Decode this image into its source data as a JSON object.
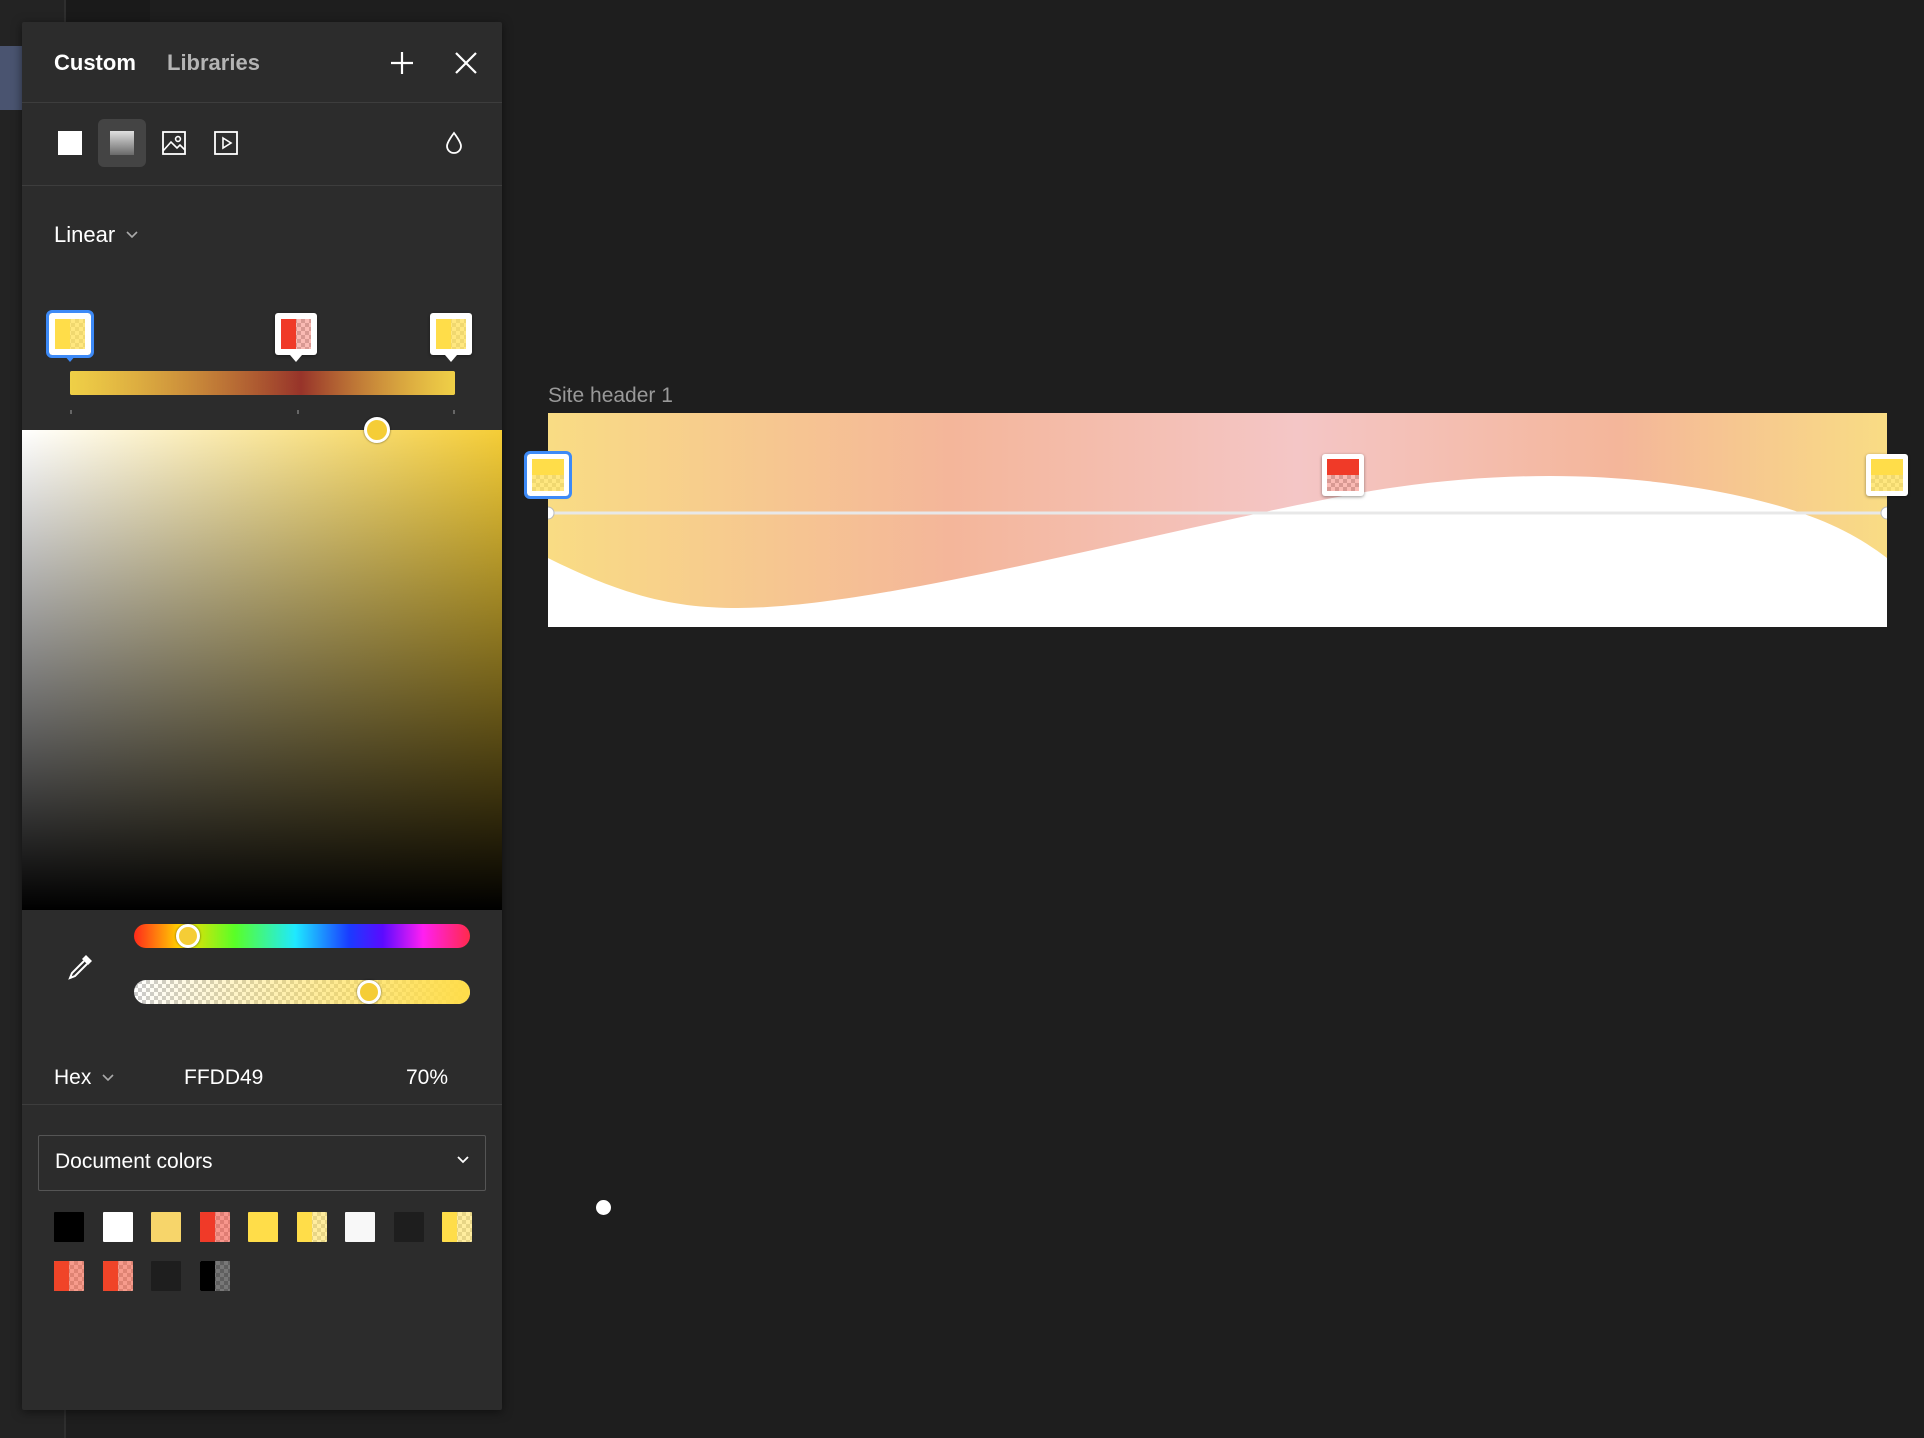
{
  "panel": {
    "tabs": [
      {
        "label": "Custom",
        "active": true
      },
      {
        "label": "Libraries",
        "active": false
      }
    ],
    "fill_types": [
      "solid-fill",
      "gradient-fill",
      "image-fill",
      "video-fill"
    ],
    "active_fill_type": "gradient-fill",
    "gradient_type": "Linear",
    "gradient_stops": [
      {
        "color": "#FFDD49",
        "opacity": 0.7,
        "selected": true
      },
      {
        "color": "#F03A28",
        "opacity": 0.35,
        "selected": false
      },
      {
        "color": "#FFDD49",
        "opacity": 0.7,
        "selected": false
      }
    ],
    "color_mode": "Hex",
    "hex_value": "FFDD49",
    "opacity_value": "70%",
    "hue_fraction": 0.16,
    "alpha_fraction": 0.7,
    "library_dropdown": "Document colors",
    "document_colors": [
      "#000000",
      "#ffffff",
      "#f7d56a",
      "#f03a28+checker",
      "#ffdd49",
      "#ffdd49+checker",
      "#f8f8f8",
      "#1e1e1e",
      "#ffdd49+checker",
      "#f04428+checker",
      "#f04428+checker",
      "#1e1e1e",
      "#000000+checker"
    ]
  },
  "canvas": {
    "frame_name": "Site header 1",
    "gradient": [
      "#f9dc84",
      "#f4b69a",
      "#f4c6c6",
      "#f4b69a",
      "#f9dc84"
    ]
  },
  "colors": {
    "accent": "#3d8af7",
    "panel_bg": "#2c2c2c",
    "canvas_bg": "#1e1e1e"
  }
}
